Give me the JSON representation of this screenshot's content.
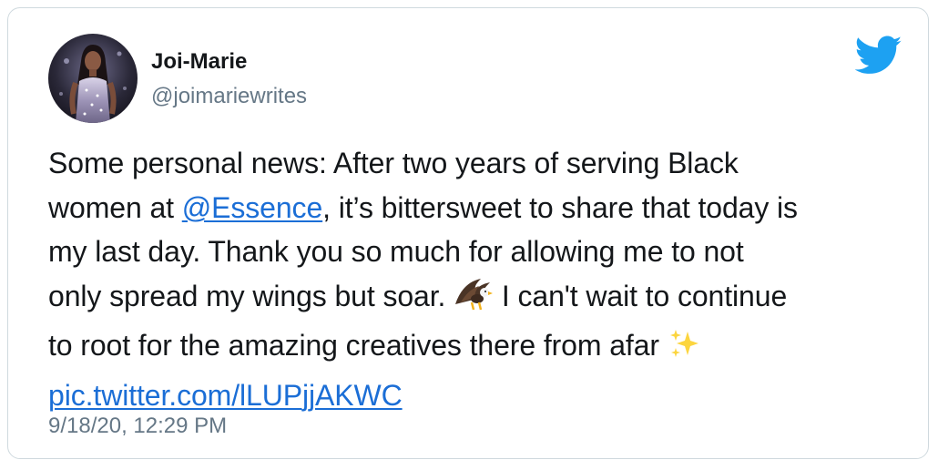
{
  "author": {
    "display_name": "Joi-Marie",
    "handle": "@joimariewrites"
  },
  "tweet": {
    "line1": "Some personal news: After two years of serving Black",
    "line2_before": "women at ",
    "mention": "@Essence",
    "line2_after": ", it’s bittersweet to share that today is",
    "line3": "my last day. Thank you so much for allowing me to not",
    "line4_before": "only spread my wings but soar. ",
    "line4_after": " I can't wait to continue",
    "line5": "to root for the amazing creatives there from afar ",
    "media_link": "pic.twitter.com/lLUPjjAKWC"
  },
  "timestamp": "9/18/20, 12:29 PM",
  "icons": {
    "brand": "twitter-bird-icon",
    "emoji1": "eagle-emoji-icon",
    "emoji2": "sparkles-emoji-icon"
  },
  "colors": {
    "twitter_blue": "#1da1f2",
    "link_blue": "#1b6ed6",
    "muted_gray": "#657786",
    "text": "#14171a",
    "border": "#cfd9de"
  }
}
